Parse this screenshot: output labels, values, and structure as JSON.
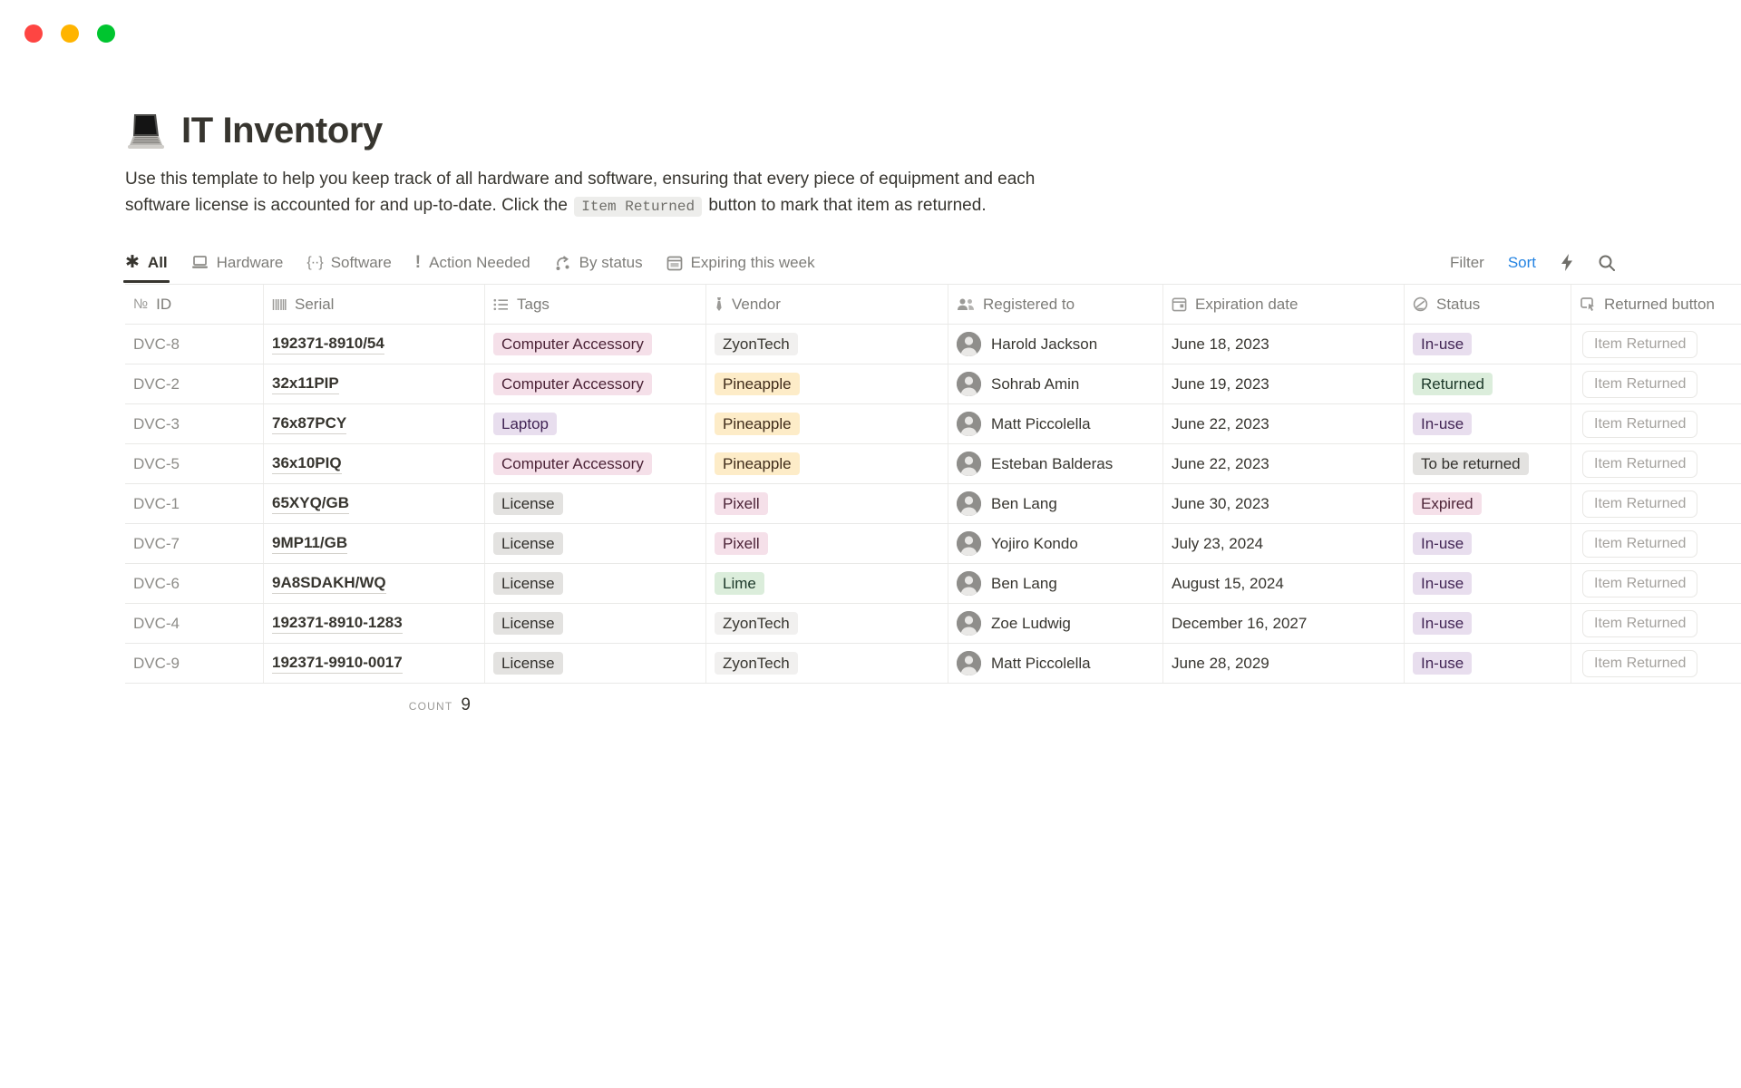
{
  "window": {
    "traffic_lights": [
      "#FE4542",
      "#FFB400",
      "#00C52F"
    ]
  },
  "page": {
    "icon": "laptop-emoji",
    "title": "IT Inventory",
    "description_line1": "Use this template to help you keep track of all hardware and software, ensuring that every piece of equipment and each",
    "description_line2_prefix": "software license is accounted for and up-to-date. Click the",
    "description_code": "Item Returned",
    "description_line2_suffix": "button to mark that item as returned."
  },
  "toolbar": {
    "tabs": [
      {
        "label": "All",
        "icon": "asterisk-icon",
        "active": true
      },
      {
        "label": "Hardware",
        "icon": "laptop-icon",
        "active": false
      },
      {
        "label": "Software",
        "icon": "code-braces-icon",
        "active": false
      },
      {
        "label": "Action Needed",
        "icon": "exclamation-icon",
        "active": false
      },
      {
        "label": "By status",
        "icon": "flow-arrow-icon",
        "active": false
      },
      {
        "label": "Expiring this week",
        "icon": "calendar-icon",
        "active": false
      }
    ],
    "filter_label": "Filter",
    "sort_label": "Sort",
    "sort_color": "#2383E2"
  },
  "palette": {
    "pink": {
      "bg": "#F5E0E9",
      "text": "#4C2337"
    },
    "purple": {
      "bg": "#E8DEEE",
      "text": "#412454"
    },
    "gray": {
      "bg": "#E3E2E0",
      "text": "#32302C"
    },
    "lightgray": {
      "bg": "#F1F0EF",
      "text": "#37352F"
    },
    "yellow": {
      "bg": "#FDECC8",
      "text": "#402C1B"
    },
    "green": {
      "bg": "#DBEDDB",
      "text": "#1C3829"
    }
  },
  "table": {
    "columns": [
      {
        "label": "ID",
        "icon": "numero-icon"
      },
      {
        "label": "Serial",
        "icon": "barcode-icon"
      },
      {
        "label": "Tags",
        "icon": "multiselect-icon"
      },
      {
        "label": "Vendor",
        "icon": "necktie-icon"
      },
      {
        "label": "Registered to",
        "icon": "people-icon"
      },
      {
        "label": "Expiration date",
        "icon": "calendar-icon"
      },
      {
        "label": "Status",
        "icon": "status-gauge-icon"
      },
      {
        "label": "Returned button",
        "icon": "button-click-icon"
      }
    ],
    "button_label": "Item Returned",
    "rows": [
      {
        "id": "DVC-8",
        "serial": "192371-8910/54",
        "tag": {
          "label": "Computer Accessory",
          "color": "pink"
        },
        "vendor": {
          "label": "ZyonTech",
          "color": "lightgray"
        },
        "person": "Harold Jackson",
        "expiration": "June 18, 2023",
        "status": {
          "label": "In-use",
          "color": "purple"
        }
      },
      {
        "id": "DVC-2",
        "serial": "32x11PIP",
        "tag": {
          "label": "Computer Accessory",
          "color": "pink"
        },
        "vendor": {
          "label": "Pineapple",
          "color": "yellow"
        },
        "person": "Sohrab Amin",
        "expiration": "June 19, 2023",
        "status": {
          "label": "Returned",
          "color": "green"
        }
      },
      {
        "id": "DVC-3",
        "serial": "76x87PCY",
        "tag": {
          "label": "Laptop",
          "color": "purple"
        },
        "vendor": {
          "label": "Pineapple",
          "color": "yellow"
        },
        "person": "Matt Piccolella",
        "expiration": "June 22, 2023",
        "status": {
          "label": "In-use",
          "color": "purple"
        }
      },
      {
        "id": "DVC-5",
        "serial": "36x10PIQ",
        "tag": {
          "label": "Computer Accessory",
          "color": "pink"
        },
        "vendor": {
          "label": "Pineapple",
          "color": "yellow"
        },
        "person": "Esteban Balderas",
        "expiration": "June 22, 2023",
        "status": {
          "label": "To be returned",
          "color": "gray"
        }
      },
      {
        "id": "DVC-1",
        "serial": "65XYQ/GB",
        "tag": {
          "label": "License",
          "color": "gray"
        },
        "vendor": {
          "label": "Pixell",
          "color": "pink"
        },
        "person": "Ben Lang",
        "expiration": "June 30, 2023",
        "status": {
          "label": "Expired",
          "color": "pink"
        }
      },
      {
        "id": "DVC-7",
        "serial": "9MP11/GB",
        "tag": {
          "label": "License",
          "color": "gray"
        },
        "vendor": {
          "label": "Pixell",
          "color": "pink"
        },
        "person": "Yojiro Kondo",
        "expiration": "July 23, 2024",
        "status": {
          "label": "In-use",
          "color": "purple"
        }
      },
      {
        "id": "DVC-6",
        "serial": "9A8SDAKH/WQ",
        "tag": {
          "label": "License",
          "color": "gray"
        },
        "vendor": {
          "label": "Lime",
          "color": "green"
        },
        "person": "Ben Lang",
        "expiration": "August 15, 2024",
        "status": {
          "label": "In-use",
          "color": "purple"
        }
      },
      {
        "id": "DVC-4",
        "serial": "192371-8910-1283",
        "tag": {
          "label": "License",
          "color": "gray"
        },
        "vendor": {
          "label": "ZyonTech",
          "color": "lightgray"
        },
        "person": "Zoe Ludwig",
        "expiration": "December 16, 2027",
        "status": {
          "label": "In-use",
          "color": "purple"
        }
      },
      {
        "id": "DVC-9",
        "serial": "192371-9910-0017",
        "tag": {
          "label": "License",
          "color": "gray"
        },
        "vendor": {
          "label": "ZyonTech",
          "color": "lightgray"
        },
        "person": "Matt Piccolella",
        "expiration": "June 28, 2029",
        "status": {
          "label": "In-use",
          "color": "purple"
        }
      }
    ],
    "footer": {
      "count_label": "COUNT",
      "count_value": "9"
    }
  }
}
